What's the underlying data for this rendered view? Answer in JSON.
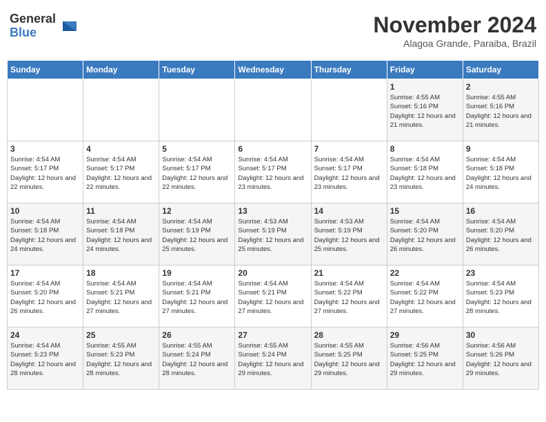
{
  "header": {
    "logo_line1": "General",
    "logo_line2": "Blue",
    "month_year": "November 2024",
    "location": "Alagoa Grande, Paraiba, Brazil"
  },
  "weekdays": [
    "Sunday",
    "Monday",
    "Tuesday",
    "Wednesday",
    "Thursday",
    "Friday",
    "Saturday"
  ],
  "weeks": [
    [
      {
        "day": "",
        "info": ""
      },
      {
        "day": "",
        "info": ""
      },
      {
        "day": "",
        "info": ""
      },
      {
        "day": "",
        "info": ""
      },
      {
        "day": "",
        "info": ""
      },
      {
        "day": "1",
        "info": "Sunrise: 4:55 AM\nSunset: 5:16 PM\nDaylight: 12 hours and 21 minutes."
      },
      {
        "day": "2",
        "info": "Sunrise: 4:55 AM\nSunset: 5:16 PM\nDaylight: 12 hours and 21 minutes."
      }
    ],
    [
      {
        "day": "3",
        "info": "Sunrise: 4:54 AM\nSunset: 5:17 PM\nDaylight: 12 hours and 22 minutes."
      },
      {
        "day": "4",
        "info": "Sunrise: 4:54 AM\nSunset: 5:17 PM\nDaylight: 12 hours and 22 minutes."
      },
      {
        "day": "5",
        "info": "Sunrise: 4:54 AM\nSunset: 5:17 PM\nDaylight: 12 hours and 22 minutes."
      },
      {
        "day": "6",
        "info": "Sunrise: 4:54 AM\nSunset: 5:17 PM\nDaylight: 12 hours and 23 minutes."
      },
      {
        "day": "7",
        "info": "Sunrise: 4:54 AM\nSunset: 5:17 PM\nDaylight: 12 hours and 23 minutes."
      },
      {
        "day": "8",
        "info": "Sunrise: 4:54 AM\nSunset: 5:18 PM\nDaylight: 12 hours and 23 minutes."
      },
      {
        "day": "9",
        "info": "Sunrise: 4:54 AM\nSunset: 5:18 PM\nDaylight: 12 hours and 24 minutes."
      }
    ],
    [
      {
        "day": "10",
        "info": "Sunrise: 4:54 AM\nSunset: 5:18 PM\nDaylight: 12 hours and 24 minutes."
      },
      {
        "day": "11",
        "info": "Sunrise: 4:54 AM\nSunset: 5:18 PM\nDaylight: 12 hours and 24 minutes."
      },
      {
        "day": "12",
        "info": "Sunrise: 4:54 AM\nSunset: 5:19 PM\nDaylight: 12 hours and 25 minutes."
      },
      {
        "day": "13",
        "info": "Sunrise: 4:53 AM\nSunset: 5:19 PM\nDaylight: 12 hours and 25 minutes."
      },
      {
        "day": "14",
        "info": "Sunrise: 4:53 AM\nSunset: 5:19 PM\nDaylight: 12 hours and 25 minutes."
      },
      {
        "day": "15",
        "info": "Sunrise: 4:54 AM\nSunset: 5:20 PM\nDaylight: 12 hours and 26 minutes."
      },
      {
        "day": "16",
        "info": "Sunrise: 4:54 AM\nSunset: 5:20 PM\nDaylight: 12 hours and 26 minutes."
      }
    ],
    [
      {
        "day": "17",
        "info": "Sunrise: 4:54 AM\nSunset: 5:20 PM\nDaylight: 12 hours and 26 minutes."
      },
      {
        "day": "18",
        "info": "Sunrise: 4:54 AM\nSunset: 5:21 PM\nDaylight: 12 hours and 27 minutes."
      },
      {
        "day": "19",
        "info": "Sunrise: 4:54 AM\nSunset: 5:21 PM\nDaylight: 12 hours and 27 minutes."
      },
      {
        "day": "20",
        "info": "Sunrise: 4:54 AM\nSunset: 5:21 PM\nDaylight: 12 hours and 27 minutes."
      },
      {
        "day": "21",
        "info": "Sunrise: 4:54 AM\nSunset: 5:22 PM\nDaylight: 12 hours and 27 minutes."
      },
      {
        "day": "22",
        "info": "Sunrise: 4:54 AM\nSunset: 5:22 PM\nDaylight: 12 hours and 27 minutes."
      },
      {
        "day": "23",
        "info": "Sunrise: 4:54 AM\nSunset: 5:23 PM\nDaylight: 12 hours and 28 minutes."
      }
    ],
    [
      {
        "day": "24",
        "info": "Sunrise: 4:54 AM\nSunset: 5:23 PM\nDaylight: 12 hours and 28 minutes."
      },
      {
        "day": "25",
        "info": "Sunrise: 4:55 AM\nSunset: 5:23 PM\nDaylight: 12 hours and 28 minutes."
      },
      {
        "day": "26",
        "info": "Sunrise: 4:55 AM\nSunset: 5:24 PM\nDaylight: 12 hours and 28 minutes."
      },
      {
        "day": "27",
        "info": "Sunrise: 4:55 AM\nSunset: 5:24 PM\nDaylight: 12 hours and 29 minutes."
      },
      {
        "day": "28",
        "info": "Sunrise: 4:55 AM\nSunset: 5:25 PM\nDaylight: 12 hours and 29 minutes."
      },
      {
        "day": "29",
        "info": "Sunrise: 4:56 AM\nSunset: 5:25 PM\nDaylight: 12 hours and 29 minutes."
      },
      {
        "day": "30",
        "info": "Sunrise: 4:56 AM\nSunset: 5:26 PM\nDaylight: 12 hours and 29 minutes."
      }
    ]
  ]
}
